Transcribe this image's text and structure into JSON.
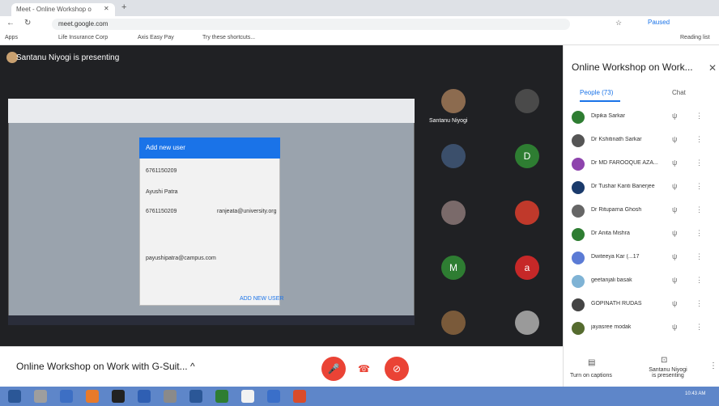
{
  "browser": {
    "tab_title": "Meet - Online Workshop o",
    "tab_close": "✕",
    "new_tab": "+",
    "url": "meet.google.com",
    "bookmarks": [
      "Apps",
      "Life Insurance Corp",
      "Axis Easy Pay",
      "Try these shortcuts..."
    ],
    "profile": "Paused",
    "reading_list": "Reading list"
  },
  "meet": {
    "presenting_label": "Santanu Niyogi is presenting",
    "pinned_name": "Santanu Niyogi",
    "meeting_title": "Online Workshop on Work with G-Suit...",
    "title_chevron": "^",
    "shared_dialog": {
      "header": "Add new user",
      "fields": [
        "6761150209",
        "Ayushi Patra",
        "6761150209",
        "ranjeata@university.org",
        "payushipatra@campus.com"
      ],
      "save": "ADD NEW USER"
    },
    "tiles": [
      {
        "type": "photo",
        "color": "#8c6b4f"
      },
      {
        "type": "photo",
        "color": "#4a4a4a"
      },
      {
        "type": "photo",
        "color": "#3b4f6b"
      },
      {
        "type": "letter",
        "letter": "D",
        "color": "#2e7d32"
      },
      {
        "type": "photo",
        "color": "#7a6a6a"
      },
      {
        "type": "photo",
        "color": "#c0392b"
      },
      {
        "type": "letter",
        "letter": "M",
        "color": "#2e7d32"
      },
      {
        "type": "letter",
        "letter": "a",
        "color": "#c62828"
      },
      {
        "type": "photo",
        "color": "#7a5a3a"
      },
      {
        "type": "photo",
        "color": "#9a9a9a"
      }
    ]
  },
  "panel": {
    "title": "Online Workshop on Work...",
    "close": "✕",
    "tab_people": "People (73)",
    "tab_chat": "Chat",
    "people": [
      {
        "name": "Dipika Sarkar",
        "color": "#2e7d32"
      },
      {
        "name": "Dr Kshitinath Sarkar",
        "color": "#555"
      },
      {
        "name": "Dr MD FAROOQUE AZA...",
        "color": "#8e44ad"
      },
      {
        "name": "Dr Tushar Kanti Banerjee",
        "color": "#1a3a6b"
      },
      {
        "name": "Dr Rituparna Ghosh",
        "color": "#666"
      },
      {
        "name": "Dr Anita Mishra",
        "color": "#2e7d32"
      },
      {
        "name": "Dwiteeya Kar (...17",
        "color": "#5b7bd5"
      },
      {
        "name": "geetanjali basak",
        "color": "#7fb3d5"
      },
      {
        "name": "GOPINATH RUDAS",
        "color": "#444"
      },
      {
        "name": "jayasree modak",
        "color": "#556b2f"
      }
    ],
    "captions_label": "Turn on captions",
    "presenter_label": "Santanu Niyogi is presenting"
  },
  "icons": {
    "mute": "ψ",
    "more": "⋮",
    "captions": "▤",
    "present": "⊡",
    "mic_off": "🎤",
    "hangup": "☎",
    "cam_off": "⊘"
  },
  "colors": {
    "accent": "#1a73e8",
    "danger": "#ea4335"
  },
  "taskbar": {
    "clock": "10:43 AM"
  }
}
